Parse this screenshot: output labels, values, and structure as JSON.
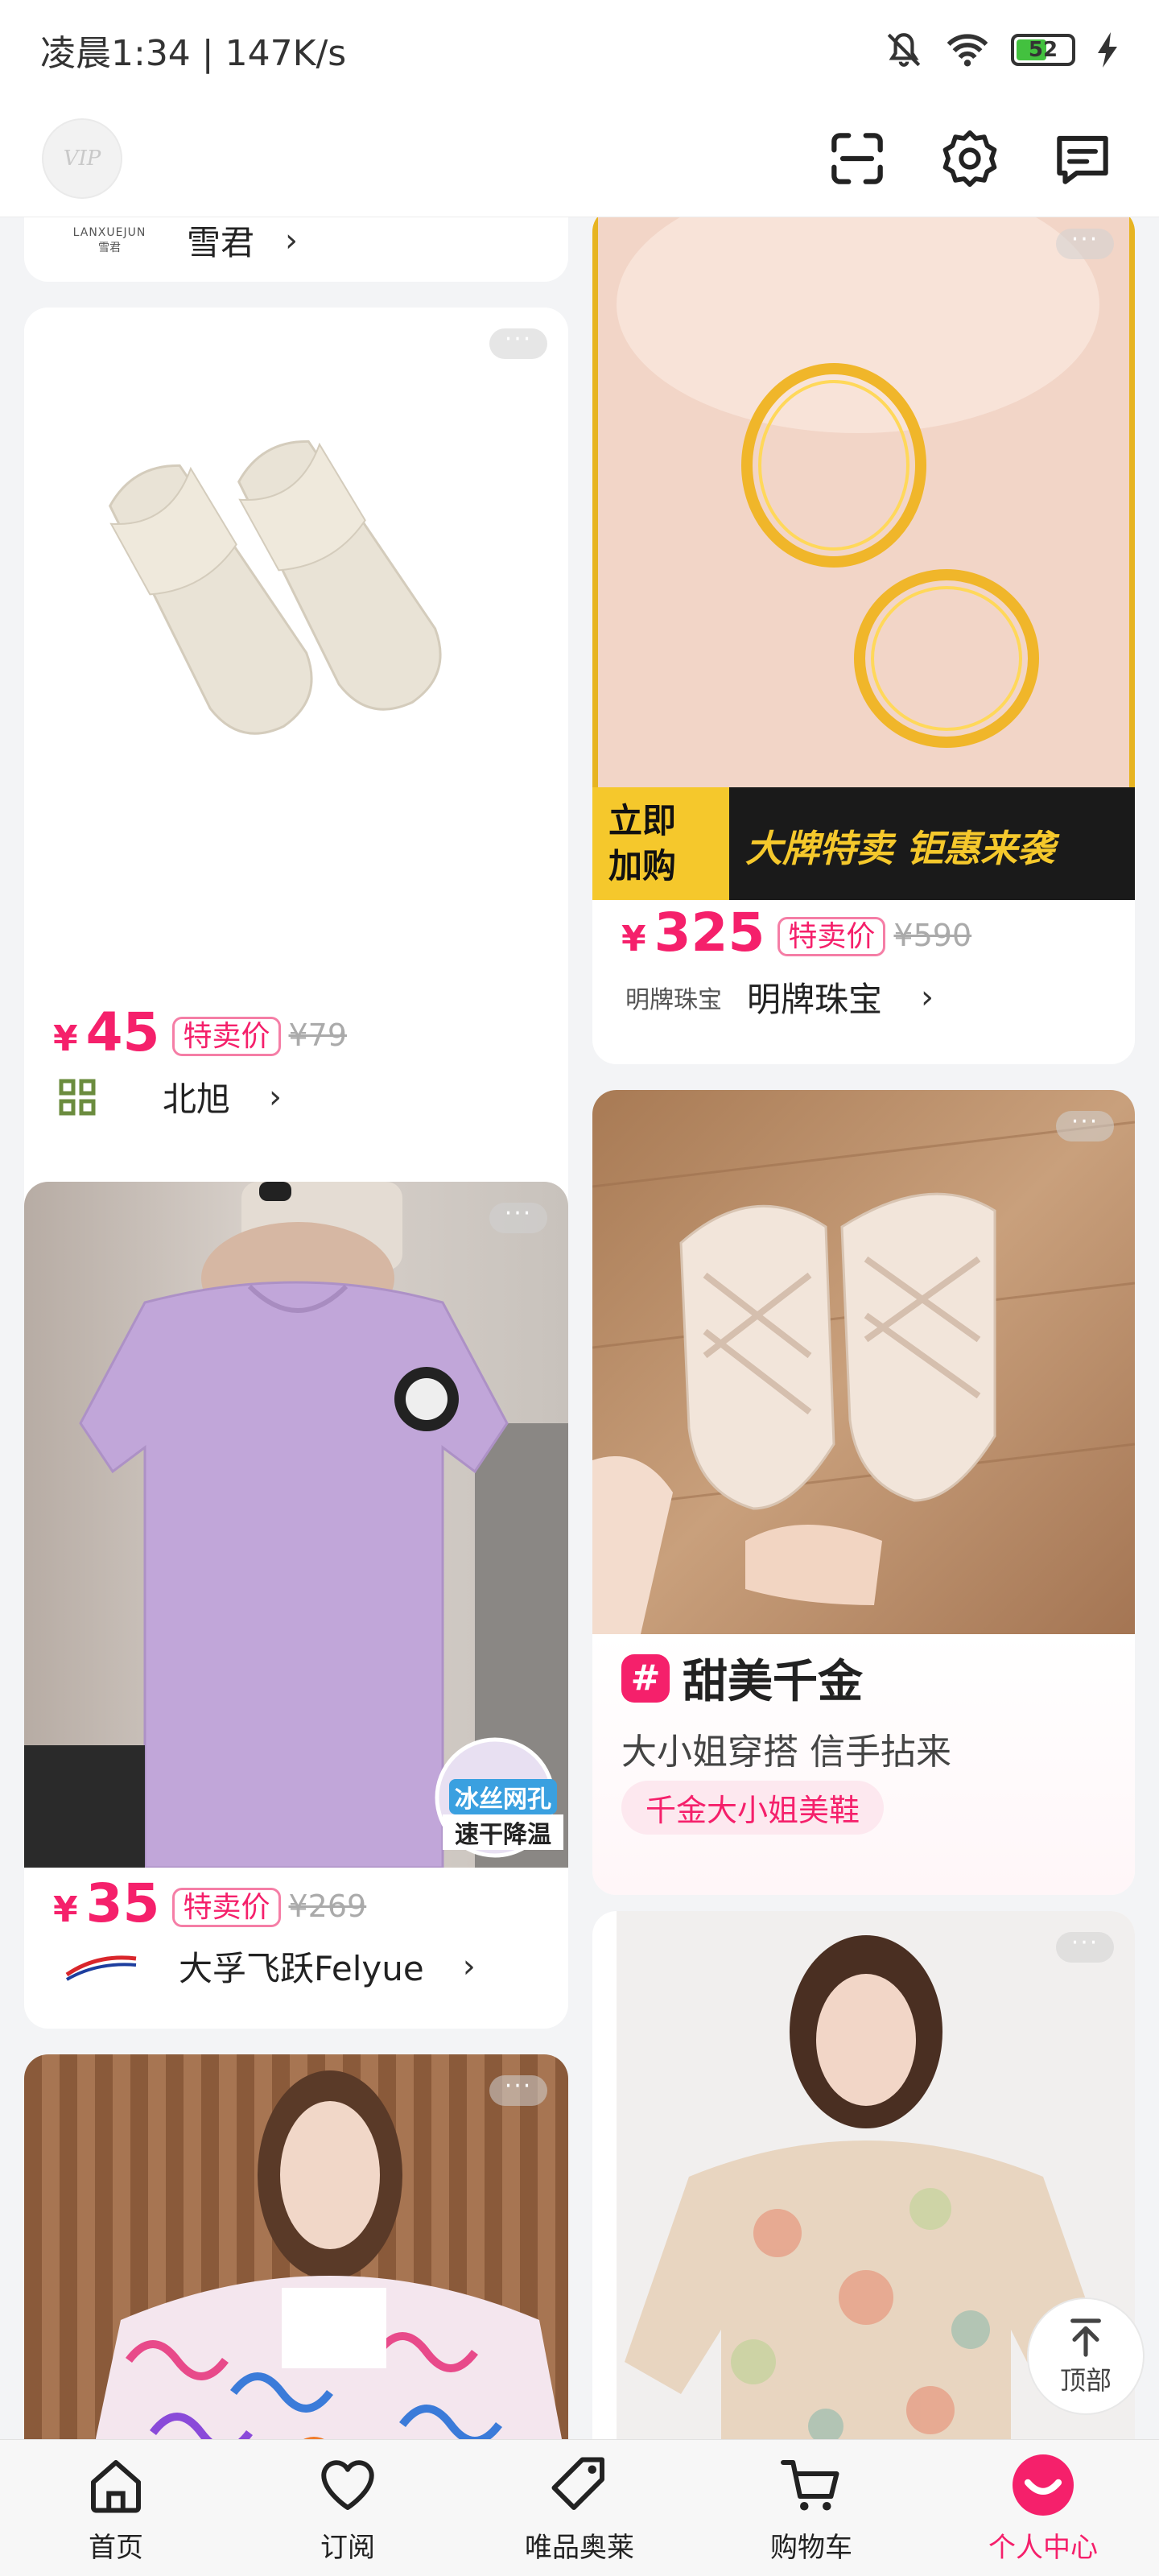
{
  "status_bar": {
    "time_speed": "凌晨1:34 | 147K/s",
    "battery": "52"
  },
  "header": {
    "vip_label": "VIP"
  },
  "left_column": [
    {
      "brand_en": "LANXUEJUN",
      "brand_cn": "雪君",
      "brand_name": "雪君"
    },
    {
      "price_symbol": "¥",
      "price": "45",
      "tag": "特卖价",
      "original_price": "¥79",
      "brand": "北旭"
    },
    {
      "price_symbol": "¥",
      "price": "35",
      "tag": "特卖价",
      "original_price": "¥269",
      "brand": "大孚飞跃Felyue",
      "badge_line1": "冰丝网孔",
      "badge_line2": "速干降温",
      "brand_logo_text": "Felyue"
    },
    {}
  ],
  "right_column": [
    {
      "price_symbol": "¥",
      "price": "325",
      "tag": "特卖价",
      "original_price": "¥590",
      "brand": "明牌珠宝",
      "brand_logo_text": "明牌珠宝",
      "banner_left": "立即\n加购",
      "banner_right": "大牌特卖 钜惠来袭"
    },
    {
      "topic_title": "甜美千金",
      "topic_subtitle": "大小姐穿搭 信手拈来",
      "topic_pill": "千金大小姐美鞋",
      "hash_symbol": "#"
    },
    {}
  ],
  "back_to_top": {
    "label": "顶部"
  },
  "bottom_nav": [
    {
      "label": "首页",
      "icon": "home-icon"
    },
    {
      "label": "订阅",
      "icon": "heart-icon"
    },
    {
      "label": "唯品奥莱",
      "icon": "tag-icon"
    },
    {
      "label": "购物车",
      "icon": "cart-icon"
    },
    {
      "label": "个人中心",
      "icon": "profile-icon",
      "active": true
    }
  ],
  "colors": {
    "accent": "#f5206b",
    "background": "#f3f4f6",
    "card": "#ffffff"
  }
}
